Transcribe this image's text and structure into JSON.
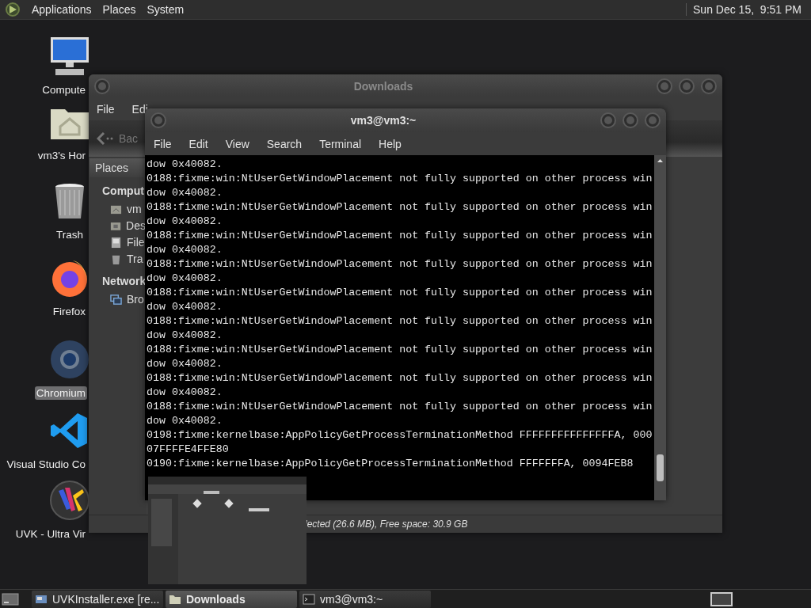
{
  "top_panel": {
    "menus": [
      "Applications",
      "Places",
      "System"
    ],
    "clock": "Sun Dec 15,  9:51 PM"
  },
  "desktop_icons": [
    {
      "label": "Compute",
      "kind": "computer",
      "selected": false
    },
    {
      "label": "vm3's Hor",
      "kind": "home",
      "selected": false
    },
    {
      "label": "Trash",
      "kind": "trash",
      "selected": false
    },
    {
      "label": "Firefox",
      "kind": "firefox",
      "selected": false
    },
    {
      "label": "Chromium",
      "kind": "chromium",
      "selected": true
    },
    {
      "label": "Visual Studio Co",
      "kind": "vscode",
      "selected": false
    },
    {
      "label": "UVK - Ultra Vir",
      "kind": "uvk",
      "selected": false
    }
  ],
  "file_manager": {
    "title": "Downloads",
    "menus": [
      "File",
      "Edi"
    ],
    "back_button": "Bac",
    "sidebar_header": "Places",
    "sidebar": [
      {
        "heading": "Comput",
        "items": [
          {
            "label": "vm",
            "kind": "home"
          },
          {
            "label": "Des",
            "kind": "desktop"
          },
          {
            "label": "File",
            "kind": "disk"
          },
          {
            "label": "Tra",
            "kind": "trash"
          }
        ]
      },
      {
        "heading": "Network",
        "items": [
          {
            "label": "Bro",
            "kind": "network"
          }
        ]
      }
    ],
    "status": "lected (26.6 MB), Free space: 30.9 GB"
  },
  "terminal": {
    "title": "vm3@vm3:~",
    "menus": [
      "File",
      "Edit",
      "View",
      "Search",
      "Terminal",
      "Help"
    ],
    "lines": [
      "dow 0x40082.",
      "0188:fixme:win:NtUserGetWindowPlacement not fully supported on other process win",
      "dow 0x40082.",
      "0188:fixme:win:NtUserGetWindowPlacement not fully supported on other process win",
      "dow 0x40082.",
      "0188:fixme:win:NtUserGetWindowPlacement not fully supported on other process win",
      "dow 0x40082.",
      "0188:fixme:win:NtUserGetWindowPlacement not fully supported on other process win",
      "dow 0x40082.",
      "0188:fixme:win:NtUserGetWindowPlacement not fully supported on other process win",
      "dow 0x40082.",
      "0188:fixme:win:NtUserGetWindowPlacement not fully supported on other process win",
      "dow 0x40082.",
      "0188:fixme:win:NtUserGetWindowPlacement not fully supported on other process win",
      "dow 0x40082.",
      "0188:fixme:win:NtUserGetWindowPlacement not fully supported on other process win",
      "dow 0x40082.",
      "0188:fixme:win:NtUserGetWindowPlacement not fully supported on other process win",
      "dow 0x40082.",
      "0198:fixme:kernelbase:AppPolicyGetProcessTerminationMethod FFFFFFFFFFFFFFFA, 000",
      "07FFFFE4FFE80",
      "0190:fixme:kernelbase:AppPolicyGetProcessTerminationMethod FFFFFFFA, 0094FEB8"
    ]
  },
  "taskbar": {
    "tasks": [
      {
        "label": "UVKInstaller.exe [re...",
        "kind": "wine",
        "selected": false
      },
      {
        "label": "Downloads",
        "kind": "folder",
        "selected": true
      },
      {
        "label": "vm3@vm3:~",
        "kind": "terminal",
        "selected": false
      }
    ]
  }
}
